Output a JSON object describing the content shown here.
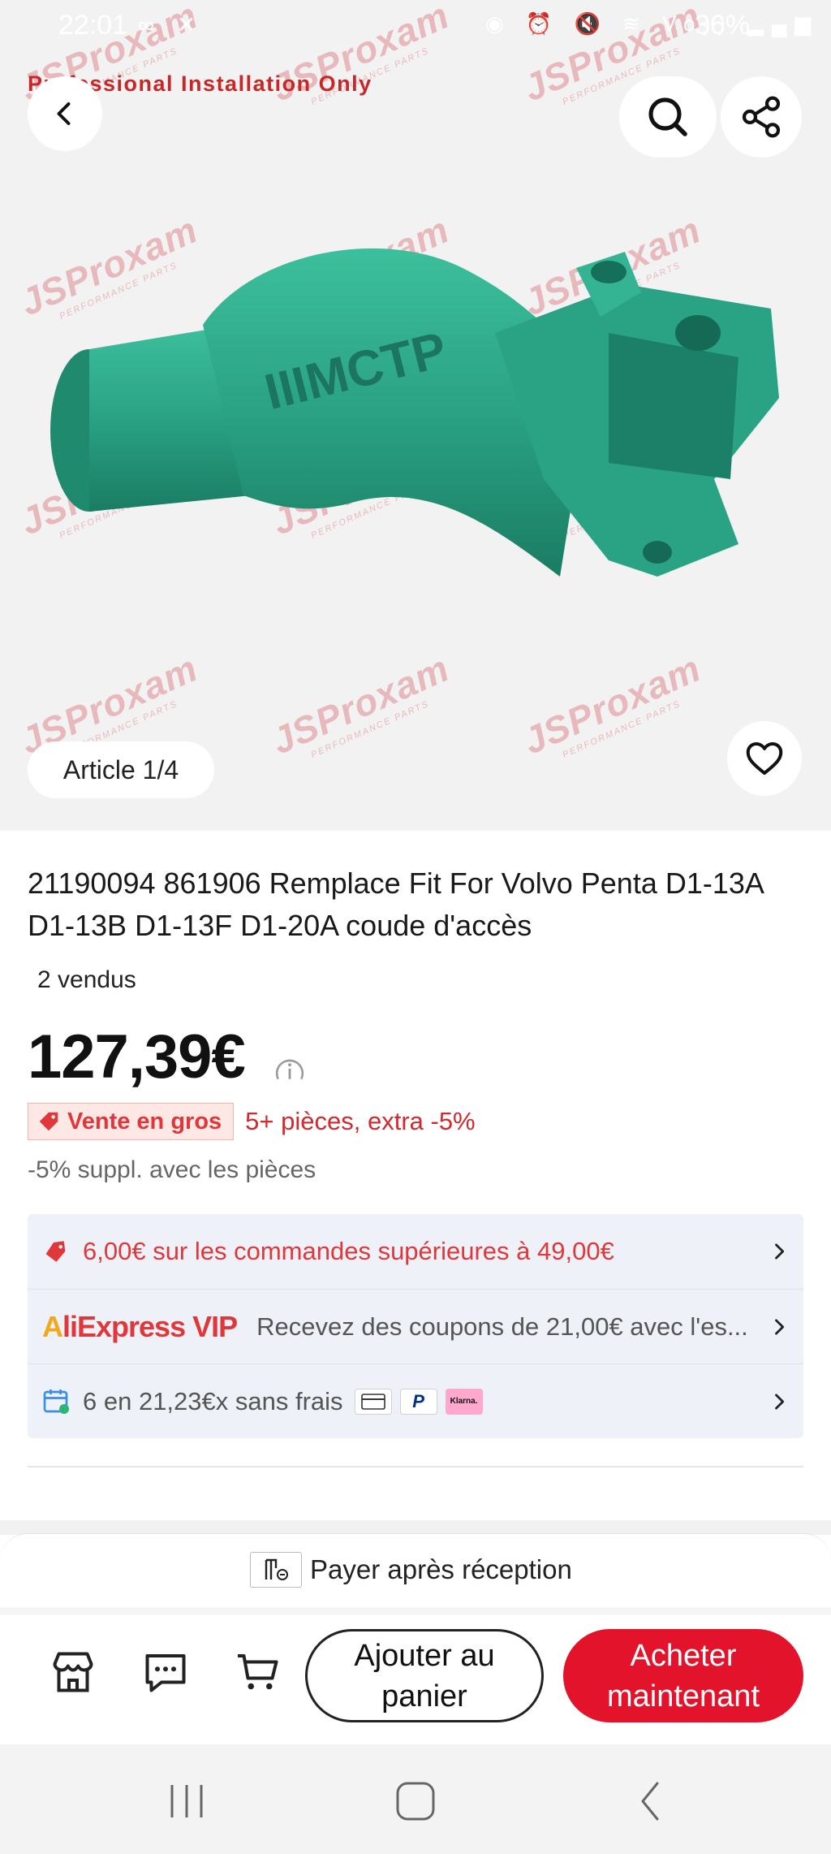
{
  "status_bar": {
    "time": "22:01",
    "left_icons": "∞ ✕",
    "right_icons": "◉ ⏰ 🔇 ≋ Vo)) ▂▄▆",
    "battery": "36%"
  },
  "hero": {
    "banner": "Professional Installation Only",
    "watermark_text": "JSProxam",
    "watermark_sub": "PERFORMANCE PARTS",
    "article_indicator": "Article 1/4"
  },
  "product": {
    "title": "21190094 861906 Remplace Fit For Volvo Penta D1-13A D1-13B D1-13F D1-20A coude d'accès",
    "sold": "2 vendus",
    "price": "127,39€",
    "wholesale_badge": "Vente en gros",
    "wholesale_text": "5+ pièces, extra -5%",
    "extra_discount": "-5% suppl. avec les pièces"
  },
  "promos": {
    "coupon": "6,00€ sur les commandes supérieures à 49,00€",
    "vip_logo": "AliExpress VIP",
    "vip_logo_a": "A",
    "vip_logo_rest": "liExpress VIP",
    "vip_text": "Recevez des coupons de 21,00€ avec l'es...",
    "installments": "6 en 21,23€x sans frais",
    "paypal_label": "P",
    "klarna_label": "Klarna."
  },
  "bottom": {
    "cod": "Payer après réception",
    "add_to_cart": "Ajouter au panier",
    "buy_now": "Acheter maintenant"
  },
  "colors": {
    "accent_red": "#e3132b",
    "promo_red": "#e0373a",
    "product_green": "#2fa48a"
  }
}
